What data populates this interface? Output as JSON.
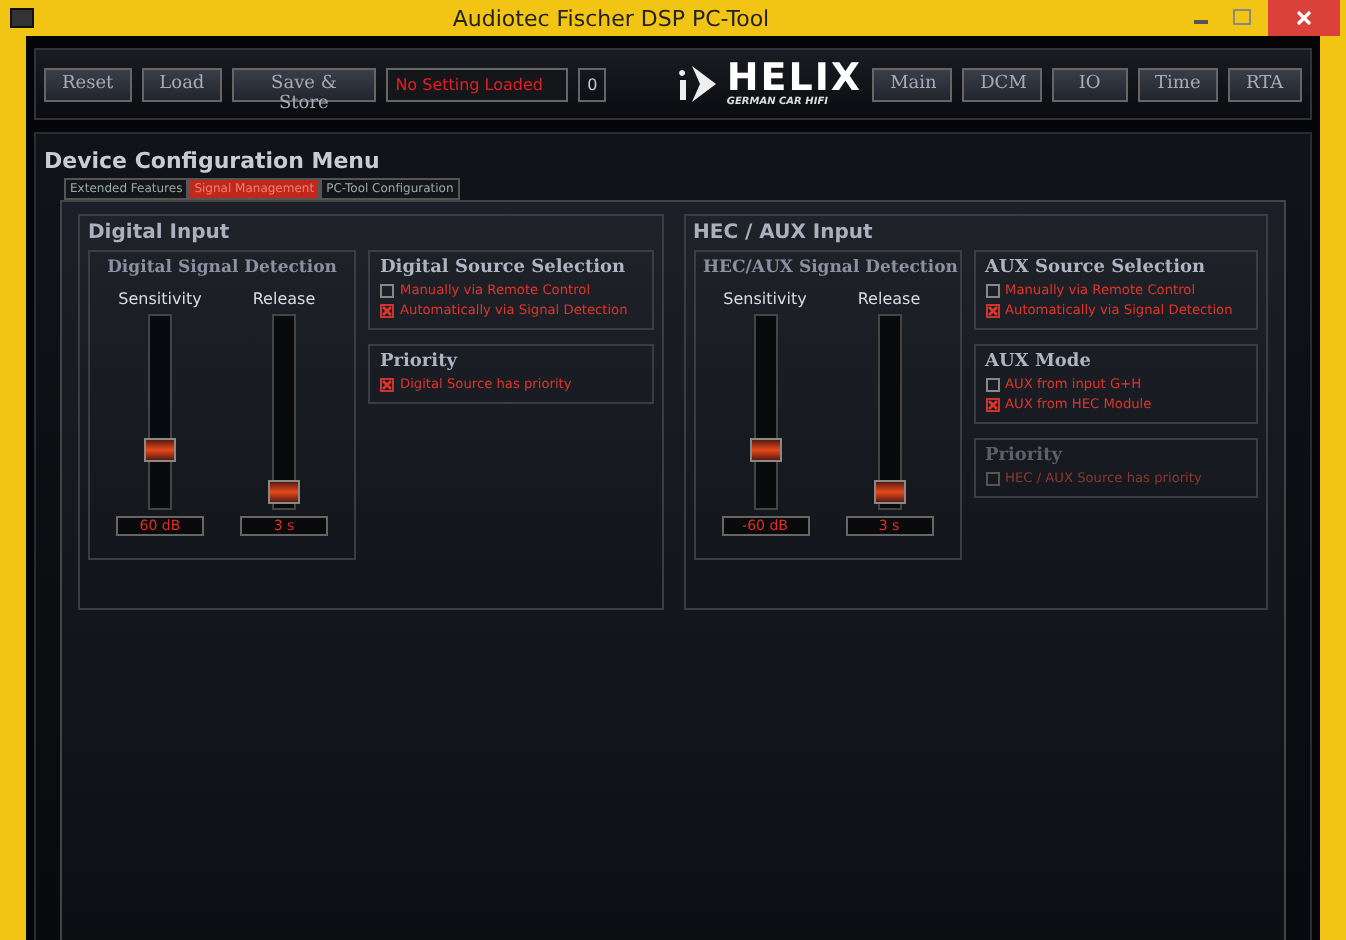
{
  "window": {
    "title": "Audiotec Fischer DSP PC-Tool"
  },
  "toolbar": {
    "left_buttons": [
      "Reset",
      "Load",
      "Save & Store"
    ],
    "status": "No Setting Loaded",
    "counter": "0",
    "logo": {
      "brand": "HELIX",
      "tagline": "GERMAN CAR HIFI"
    },
    "right_buttons": [
      "Main",
      "DCM",
      "IO",
      "Time",
      "RTA"
    ]
  },
  "menu_title": "Device Configuration Menu",
  "tabs": [
    {
      "label": "Extended Features",
      "selected": false
    },
    {
      "label": "Signal Management",
      "selected": true
    },
    {
      "label": "PC-Tool Configuration",
      "selected": false
    }
  ],
  "sections": [
    {
      "title": "Digital Input",
      "detection": {
        "title": "Digital Signal Detection",
        "sliders": [
          {
            "label": "Sensitivity",
            "level": 0.3,
            "reading": "60 dB"
          },
          {
            "label": "Release",
            "level": 0.08,
            "reading": "3 s"
          }
        ]
      },
      "groups": [
        {
          "title": "Digital Source Selection",
          "disabled": false,
          "options": [
            {
              "label": "Manually via Remote Control",
              "checked": false
            },
            {
              "label": "Automatically via Signal Detection",
              "checked": true
            }
          ]
        },
        {
          "title": "Priority",
          "disabled": false,
          "options": [
            {
              "label": "Digital Source has priority",
              "checked": true
            }
          ]
        }
      ]
    },
    {
      "title": "HEC / AUX Input",
      "detection": {
        "title": "HEC/AUX Signal Detection",
        "sliders": [
          {
            "label": "Sensitivity",
            "level": 0.3,
            "reading": "-60 dB"
          },
          {
            "label": "Release",
            "level": 0.08,
            "reading": "3 s"
          }
        ]
      },
      "groups": [
        {
          "title": "AUX Source Selection",
          "disabled": false,
          "options": [
            {
              "label": "Manually via Remote Control",
              "checked": false
            },
            {
              "label": "Automatically via Signal Detection",
              "checked": true
            }
          ]
        },
        {
          "title": "AUX Mode",
          "disabled": false,
          "options": [
            {
              "label": "AUX from input G+H",
              "checked": false
            },
            {
              "label": "AUX from HEC Module",
              "checked": true
            }
          ]
        },
        {
          "title": "Priority",
          "disabled": true,
          "options": [
            {
              "label": "HEC / AUX Source has priority",
              "checked": false
            }
          ]
        }
      ]
    }
  ]
}
